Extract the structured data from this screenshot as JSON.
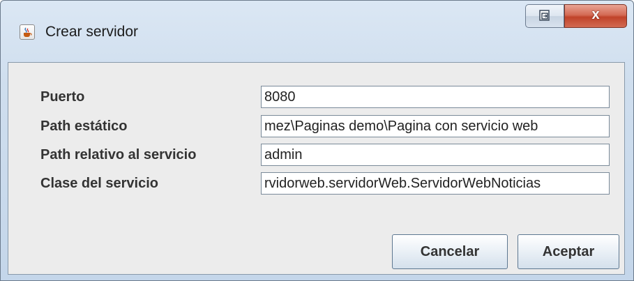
{
  "window": {
    "title": "Crear servidor",
    "app_icon": "java-cup-icon",
    "close_label": "x",
    "restore_icon": "restore-icon"
  },
  "form": {
    "fields": [
      {
        "label": "Puerto",
        "value": "8080"
      },
      {
        "label": "Path estático",
        "value": "mez\\Paginas demo\\Pagina con servicio web"
      },
      {
        "label": "Path relativo al servicio",
        "value": "admin"
      },
      {
        "label": "Clase del servicio",
        "value": "rvidorweb.servidorWeb.ServidorWebNoticias"
      }
    ]
  },
  "buttons": {
    "cancel_label": "Cancelar",
    "accept_label": "Aceptar"
  },
  "colors": {
    "titlebar": "#cfdeee",
    "close_button": "#c0432a",
    "content_bg": "#ececec"
  }
}
